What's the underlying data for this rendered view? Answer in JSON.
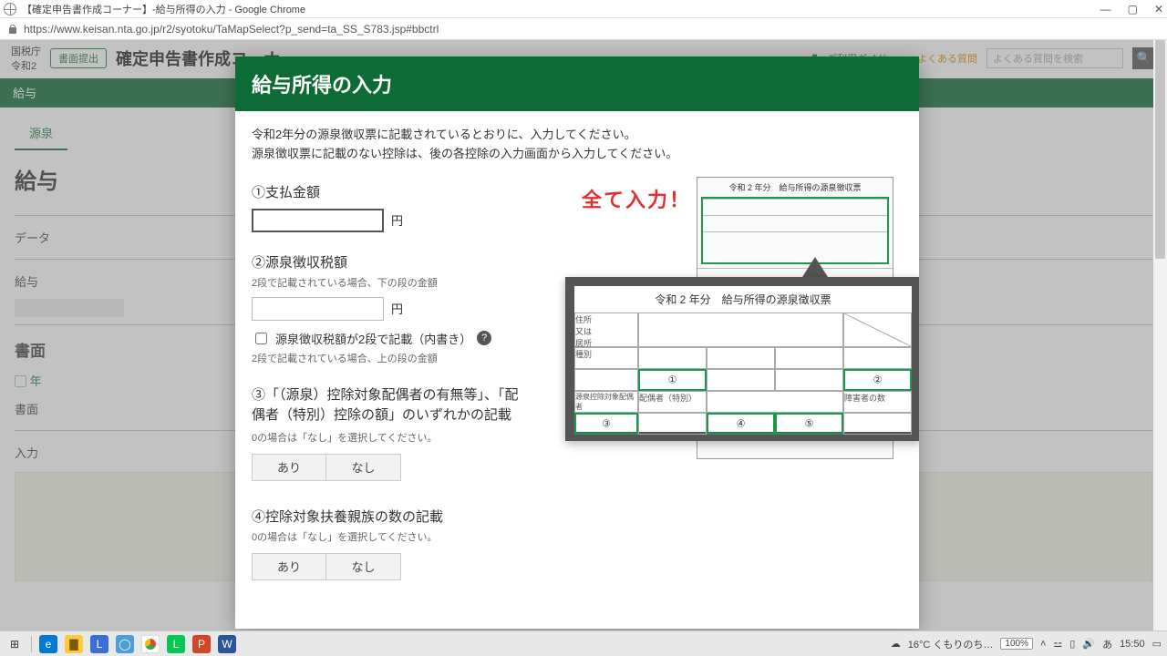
{
  "window": {
    "title": "【確定申告書作成コーナー】-給与所得の入力 - Google Chrome",
    "url": "https://www.keisan.nta.go.jp/r2/syotoku/TaMapSelect?p_send=ta_SS_S783.jsp#bbctrl"
  },
  "page_bg": {
    "agency1": "国税庁",
    "agency2": "令和2",
    "pill": "書面提出",
    "app_title": "確定申告書作成コーナー",
    "guide": "ご利用ガイド",
    "faq": "よくある質問",
    "search_placeholder": "よくある質問を検索",
    "crumb1": "給与",
    "crumb2": "源泉",
    "h1": "給与",
    "sec1": "データ",
    "sec2": "給与",
    "sec3": "書面",
    "sec3b": "年",
    "sec4": "書面",
    "sec5": "入力"
  },
  "modal": {
    "title": "給与所得の入力",
    "instr1": "令和2年分の源泉徴収票に記載されているとおりに、入力してください。",
    "instr2": "源泉徴収票に記載のない控除は、後の各控除の入力画面から入力してください。",
    "annotation": "全て入力！",
    "yen": "円",
    "help": "?",
    "f1": {
      "title": "①支払金額"
    },
    "f2": {
      "title": "②源泉徴収税額",
      "sub": "2段で記載されている場合、下の段の金額",
      "cb": "源泉徴収税額が2段で記載（内書き）",
      "sub2": "2段で記載されている場合、上の段の金額"
    },
    "f3": {
      "title": "③「（源泉）控除対象配偶者の有無等」、「配偶者（特別）控除の額」のいずれかの記載",
      "sub": "0の場合は「なし」を選択してください。"
    },
    "f4": {
      "title": "④控除対象扶養親族の数の記載",
      "sub": "0の場合は「なし」を選択してください。"
    },
    "btn_yes": "あり",
    "btn_no": "なし",
    "doc": {
      "mini_title": "令和 2 年分　給与所得の源泉徴収票",
      "zoom_title": "令和 2 年分　給与所得の源泉徴収票",
      "n1": "①",
      "n2": "②",
      "n3": "③",
      "n4": "④",
      "n5": "⑤"
    }
  },
  "taskbar": {
    "weather": "16°C くもりのち…",
    "zoom": "100%",
    "ime": "あ",
    "time": "15:50"
  }
}
